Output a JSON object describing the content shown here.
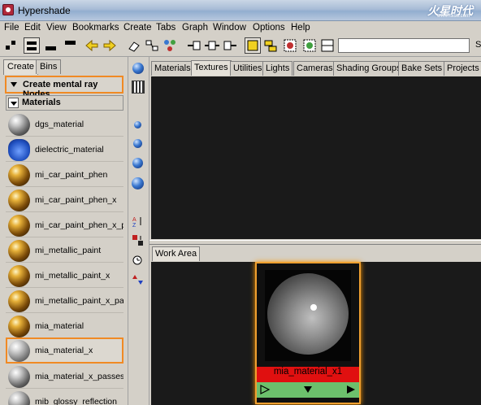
{
  "window": {
    "title": "Hypershade",
    "watermark": "火星时代",
    "watermark_url": "www.hxsd.com"
  },
  "menubar": [
    "File",
    "Edit",
    "View",
    "Bookmarks",
    "Create",
    "Tabs",
    "Graph",
    "Window",
    "Options",
    "Help"
  ],
  "toolbar": {
    "search_value": "",
    "trailing_label": "S"
  },
  "left_tabs": [
    "Create",
    "Bins"
  ],
  "create_dropdown": "Create mental ray Nodes",
  "materials_header": "Materials",
  "materials": [
    {
      "label": "dgs_material",
      "icon": "gray-sphere"
    },
    {
      "label": "dielectric_material",
      "icon": "dielectric-icon"
    },
    {
      "label": "mi_car_paint_phen",
      "icon": "gold-sphere"
    },
    {
      "label": "mi_car_paint_phen_x",
      "icon": "gold-sphere"
    },
    {
      "label": "mi_car_paint_phen_x_pa",
      "icon": "gold-sphere"
    },
    {
      "label": "mi_metallic_paint",
      "icon": "gold-sphere"
    },
    {
      "label": "mi_metallic_paint_x",
      "icon": "gold-sphere"
    },
    {
      "label": "mi_metallic_paint_x_pass",
      "icon": "gold-sphere"
    },
    {
      "label": "mia_material",
      "icon": "gold-sphere"
    },
    {
      "label": "mia_material_x",
      "icon": "checker-sphere",
      "selected": true
    },
    {
      "label": "mia_material_x_passes",
      "icon": "gray-sphere"
    },
    {
      "label": "mib_glossy_reflection",
      "icon": "gray-sphere"
    }
  ],
  "top_tabs": [
    "Materials",
    "Textures",
    "Utilities",
    "Lights",
    "Cameras",
    "Shading Groups",
    "Bake Sets",
    "Projects"
  ],
  "top_active_tab": "Textures",
  "work_area_tab": "Work Area",
  "node": {
    "name": "mia_material_x1"
  },
  "colors": {
    "selection_orange": "#f08a24",
    "node_name_bar": "#e01010",
    "node_ctrl_bar": "#6cc06c",
    "panel_bg": "#1a1a1a"
  }
}
